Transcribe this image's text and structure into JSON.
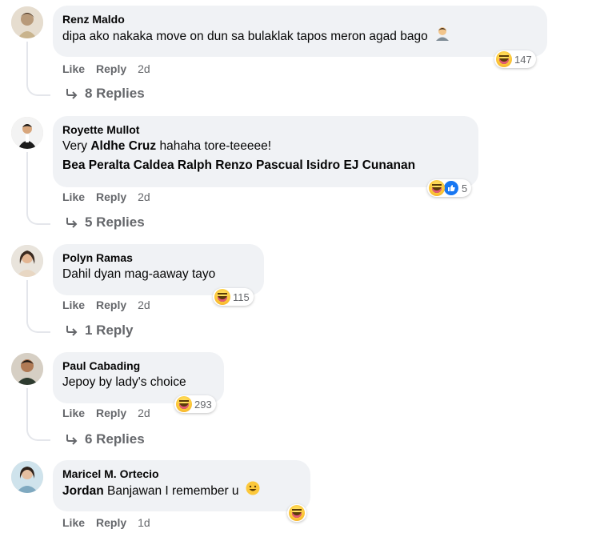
{
  "comments": [
    {
      "name": "Renz Maldo",
      "text": "dipa ako nakaka move on dun sa bulaklak tapos meron agad bago",
      "reaction_count": "147",
      "like": "Like",
      "reply": "Reply",
      "time": "2d",
      "replies": "8 Replies"
    },
    {
      "name": "Royette Mullot",
      "line1_pre": "Very",
      "line1_mention": "Aldhe Cruz",
      "line1_post": "hahaha tore-teeeee!",
      "line2_mentions": "Bea Peralta Caldea Ralph Renzo Pascual Isidro EJ Cunanan",
      "reaction_count": "5",
      "like": "Like",
      "reply": "Reply",
      "time": "2d",
      "replies": "5 Replies"
    },
    {
      "name": "Polyn Ramas",
      "text": "Dahil dyan mag-aaway tayo",
      "reaction_count": "115",
      "like": "Like",
      "reply": "Reply",
      "time": "2d",
      "replies": "1 Reply"
    },
    {
      "name": "Paul Cabading",
      "text": "Jepoy by lady's choice",
      "reaction_count": "293",
      "like": "Like",
      "reply": "Reply",
      "time": "2d",
      "replies": "6 Replies"
    },
    {
      "name": "Maricel M. Ortecio",
      "mention": "Jordan",
      "text": "Banjawan I remember u",
      "like": "Like",
      "reply": "Reply",
      "time": "1d"
    }
  ],
  "icons": {
    "reply_arrow": "reply-arrow-icon",
    "haha": "haha-reaction-icon",
    "like": "like-reaction-icon"
  },
  "colors": {
    "bubble": "#f0f2f5",
    "secondary_text": "#65676b",
    "like_blue": "#1877f2",
    "haha_yellow": "#fcc83b"
  }
}
